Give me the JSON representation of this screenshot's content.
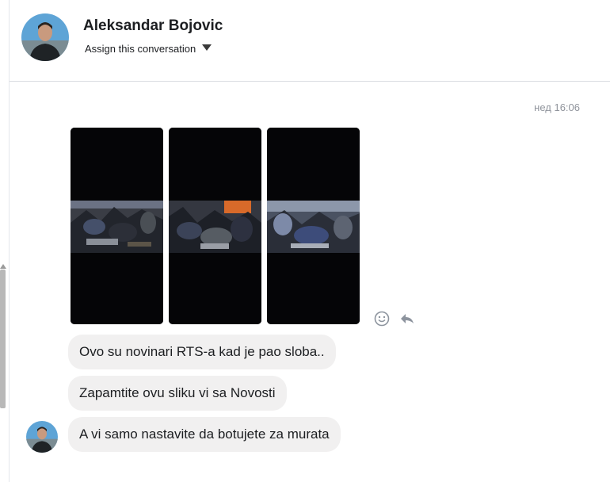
{
  "header": {
    "contact_name": "Aleksandar Bojovic",
    "assign_label": "Assign this conversation",
    "avatar_icon": "profile-photo"
  },
  "conversation": {
    "timestamp": "нед 16:06",
    "photos": [
      {
        "name": "shared-photo-1"
      },
      {
        "name": "shared-photo-2"
      },
      {
        "name": "shared-photo-3"
      }
    ],
    "tools": [
      "emoji-reaction-icon",
      "reply-icon"
    ],
    "messages": [
      {
        "text": "Ovo su novinari RTS-a kad je pao sloba.."
      },
      {
        "text": "Zapamtite ovu sliku vi sa Novosti"
      },
      {
        "text": "A vi samo nastavite da botujete za murata"
      }
    ]
  }
}
